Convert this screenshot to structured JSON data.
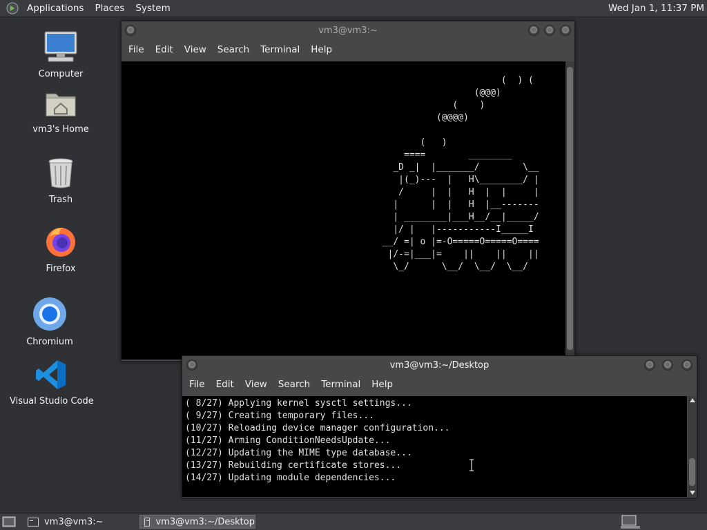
{
  "top_panel": {
    "menus": [
      "Applications",
      "Places",
      "System"
    ],
    "clock": "Wed Jan  1, 11:37 PM"
  },
  "desktop_icons": [
    {
      "label": "Computer",
      "icon": "computer-icon"
    },
    {
      "label": "vm3's Home",
      "icon": "home-folder-icon"
    },
    {
      "label": "Trash",
      "icon": "trash-icon"
    },
    {
      "label": "Firefox",
      "icon": "firefox-icon"
    },
    {
      "label": "Chromium",
      "icon": "chromium-icon"
    },
    {
      "label": "Visual Studio Code",
      "icon": "vscode-icon"
    }
  ],
  "window1": {
    "title": "vm3@vm3:~",
    "menu": [
      "File",
      "Edit",
      "View",
      "Search",
      "Terminal",
      "Help"
    ],
    "content": "                                                                      (  ) (\n                                                                 (@@@)\n                                                             (    )\n                                                          (@@@@)\n\n                                                       (   )\n                                                    ====        ________\n                                                  _D _|  |_______/        \\__\n                                                   |(_)---  |   H\\________/ |\n                                                   /     |  |   H  |  |     |\n                                                  |      |  |   H  |__-------\n                                                  | ________|___H__/__|_____/\n                                                  |/ |   |-----------I_____I\n                                                __/ =| o |=-O=====O=====O====\n                                                 |/-=|___|=    ||    ||    ||\n                                                  \\_/      \\__/  \\__/  \\__/"
  },
  "window2": {
    "title": "vm3@vm3:~/Desktop",
    "menu": [
      "File",
      "Edit",
      "View",
      "Search",
      "Terminal",
      "Help"
    ],
    "lines": [
      "( 8/27) Applying kernel sysctl settings...",
      "( 9/27) Creating temporary files...",
      "(10/27) Reloading device manager configuration...",
      "(11/27) Arming ConditionNeedsUpdate...",
      "(12/27) Updating the MIME type database...",
      "(13/27) Rebuilding certificate stores...",
      "(14/27) Updating module dependencies..."
    ]
  },
  "taskbar": {
    "tasks": [
      {
        "label": "vm3@vm3:~",
        "active": false
      },
      {
        "label": "vm3@vm3:~/Desktop",
        "active": true
      }
    ]
  },
  "colors": {
    "desktop_bg": "#2f3134",
    "panel_bg": "#3a3c3f",
    "window_frame": "#454749",
    "terminal_bg": "#000000",
    "terminal_fg": "#e0e0e0"
  }
}
